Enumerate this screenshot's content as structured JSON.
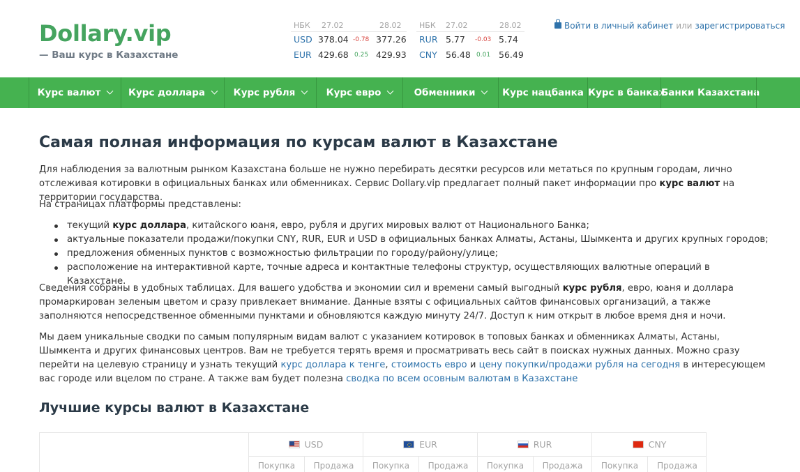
{
  "header": {
    "logo": "Dollary.vip",
    "tagline": "— Ваш курс в Казахстане",
    "rates_left": {
      "source": "НБК",
      "date1": "27.02",
      "date2": "28.02",
      "rows": [
        {
          "code": "USD",
          "v1": "378.04",
          "delta": "-0.78",
          "v2": "377.26"
        },
        {
          "code": "EUR",
          "v1": "429.68",
          "delta": "0.25",
          "v2": "429.93"
        }
      ]
    },
    "rates_right": {
      "source": "НБК",
      "date1": "27.02",
      "date2": "28.02",
      "rows": [
        {
          "code": "RUR",
          "v1": "5.77",
          "delta": "-0.03",
          "v2": "5.74"
        },
        {
          "code": "CNY",
          "v1": "56.48",
          "delta": "0.01",
          "v2": "56.49"
        }
      ]
    },
    "auth": {
      "login": "Войти в личный кабинет",
      "or": "или",
      "register": "зарегистрироваться"
    }
  },
  "nav": {
    "items": [
      {
        "label": "Курс валют"
      },
      {
        "label": "Курс доллара"
      },
      {
        "label": "Курс рубля"
      },
      {
        "label": "Курс евро"
      },
      {
        "label": "Обменники"
      },
      {
        "label": "Курс нацбанка"
      },
      {
        "label": "Курс в банках"
      },
      {
        "label": "Банки Казахстана"
      }
    ]
  },
  "main": {
    "title": "Самая полная информация по курсам валют в Казахстане",
    "p1": {
      "t1": "Для наблюдения за валютным рынком Казахстана больше не нужно перебирать десятки ресурсов или метаться по крупным городам, лично отслеживая котировки в официальных банках или обменниках. Сервис Dollary.vip предлагает полный пакет информации про ",
      "b1": "курс валют",
      "t2": " на территории государства."
    },
    "p2": "На страницах платформы представлены:",
    "list": {
      "i1a": "текущий ",
      "i1b": "курс доллара",
      "i1c": ", китайского юаня, евро, рубля и других мировых валют от Национального Банка;",
      "i2": "актуальные показатели продажи/покупки CNY, RUR, EUR и USD в официальных банках Алматы, Астаны, Шымкента и других крупных городов;",
      "i3": "предложения обменных пунктов с возможностью фильтрации по городу/району/улице;",
      "i4": "расположение на интерактивной карте, точные адреса и контактные телефоны структур, осуществляющих валютные операций в Казахстане."
    },
    "p3": {
      "t1": "Сведения собраны в удобных таблицах. Для вашего удобства и экономии сил и времени самый выгодный ",
      "b1": "курс рубля",
      "t2": ", евро, юаня и доллара промаркирован зеленым цветом и сразу привлекает внимание. Данные взяты с официальных сайтов финансовых организаций, а также заполняются непосредственное обменными пунктами и обновляются каждую минуту 24/7. Доступ к ним открыт в любое время дня и ночи."
    },
    "p4": {
      "t1": "Мы даем уникальные сводки по самым популярным видам валют с указанием котировок в топовых банках и обменниках Алматы, Астаны, Шымкента и других финансовых центров. Вам не требуется терять время и просматривать весь сайт в поисках нужных данных. Можно сразу перейти на целевую страницу и узнать текущий ",
      "l1": "курс доллара к тенге",
      "s1": ", ",
      "l2": "стоимость евро",
      "s2": " и ",
      "l3": "цену покупки/продажи рубля на сегодня",
      "t2": " в интересующем вас городе или вцелом по стране. А также вам будет полезна ",
      "l4": "сводка по всем осовным валютам в Казахстане"
    },
    "subtitle": "Лучшие курсы валют в Казахстане"
  },
  "table": {
    "currencies": [
      {
        "code": "USD",
        "flag": "us-flag"
      },
      {
        "code": "EUR",
        "flag": "eu-flag"
      },
      {
        "code": "RUR",
        "flag": "ru-flag"
      },
      {
        "code": "CNY",
        "flag": "cn-flag"
      }
    ],
    "buy": "Покупка",
    "sell": "Продажа"
  },
  "colors": {
    "brand_green": "#45b250",
    "link_blue": "#2f73ab",
    "negative": "#d8433d",
    "positive": "#45a45f"
  }
}
